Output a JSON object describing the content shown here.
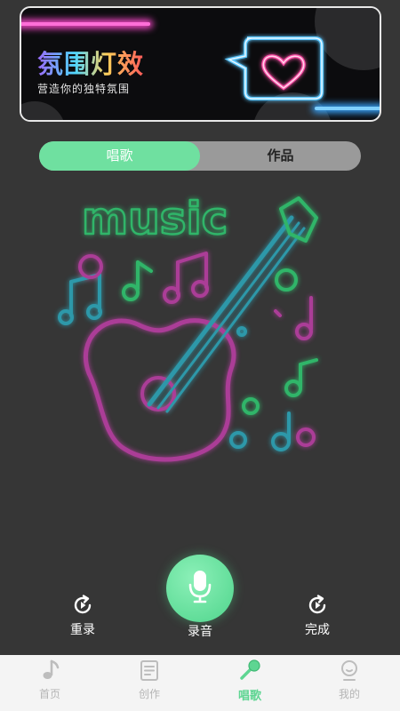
{
  "banner": {
    "title": "氛围灯效",
    "subtitle": "营造你的独特氛围",
    "heart_icon": "heart-bubble-icon"
  },
  "tabs": [
    {
      "label": "唱歌",
      "active": true
    },
    {
      "label": "作品",
      "active": false
    }
  ],
  "artwork": {
    "word": "music",
    "colors": {
      "green": "#3cff7a",
      "pink": "#ff3fd0",
      "cyan": "#2ee6ff"
    }
  },
  "controls": {
    "redo_label": "重录",
    "record_label": "录音",
    "finish_label": "完成"
  },
  "nav": {
    "items": [
      {
        "label": "首页",
        "icon": "music-note-icon",
        "active": false
      },
      {
        "label": "创作",
        "icon": "document-icon",
        "active": false
      },
      {
        "label": "唱歌",
        "icon": "microphone-icon",
        "active": true
      },
      {
        "label": "我的",
        "icon": "profile-icon",
        "active": false
      }
    ]
  },
  "colors": {
    "accent": "#5ed592",
    "background": "#363636"
  }
}
